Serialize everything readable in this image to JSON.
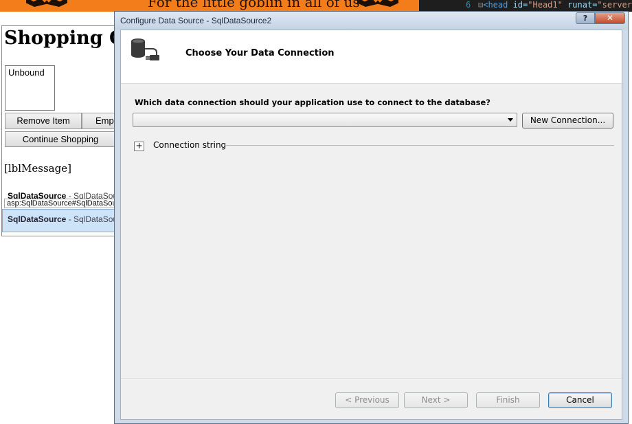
{
  "background": {
    "banner_text": "For the little goblin in all of us",
    "code": {
      "line_number": "6",
      "fold_glyph": "⊟",
      "tag_open": "<head",
      "attr1": " id=",
      "val1": "\"Head1\"",
      "attr2": " runat=",
      "val2": "\"server\""
    },
    "page_title": "Shopping C",
    "listbox_text": "Unbound",
    "remove_item_label": "Remove Item",
    "empty_label": "Emp",
    "continue_label": "Continue Shopping",
    "lbl_message": "[lblMessage]",
    "sds_line_name": "SqlDataSource",
    "sds_line_rest": " - SqlDataSour",
    "sds_tag": "asp:SqlDataSource#SqlDataSou",
    "sds_selected_name": "SqlDataSource",
    "sds_selected_rest": " - SqlDataSour"
  },
  "dialog": {
    "title": "Configure Data Source - SqlDataSource2",
    "help_glyph": "?",
    "close_glyph": "✕",
    "header_title": "Choose Your Data Connection",
    "header_icon": "database-plug-icon",
    "question": "Which data connection should your application use to connect to the database?",
    "connection_value": "",
    "new_connection_label": "New Connection...",
    "expand_glyph": "+",
    "connection_string_label": "Connection string",
    "buttons": {
      "previous": "< Previous",
      "next": "Next >",
      "finish": "Finish",
      "cancel": "Cancel"
    }
  },
  "colors": {
    "banner": "#f27d1a",
    "selection": "#cde3f7",
    "dialog_frame": "#cfdbe8"
  }
}
